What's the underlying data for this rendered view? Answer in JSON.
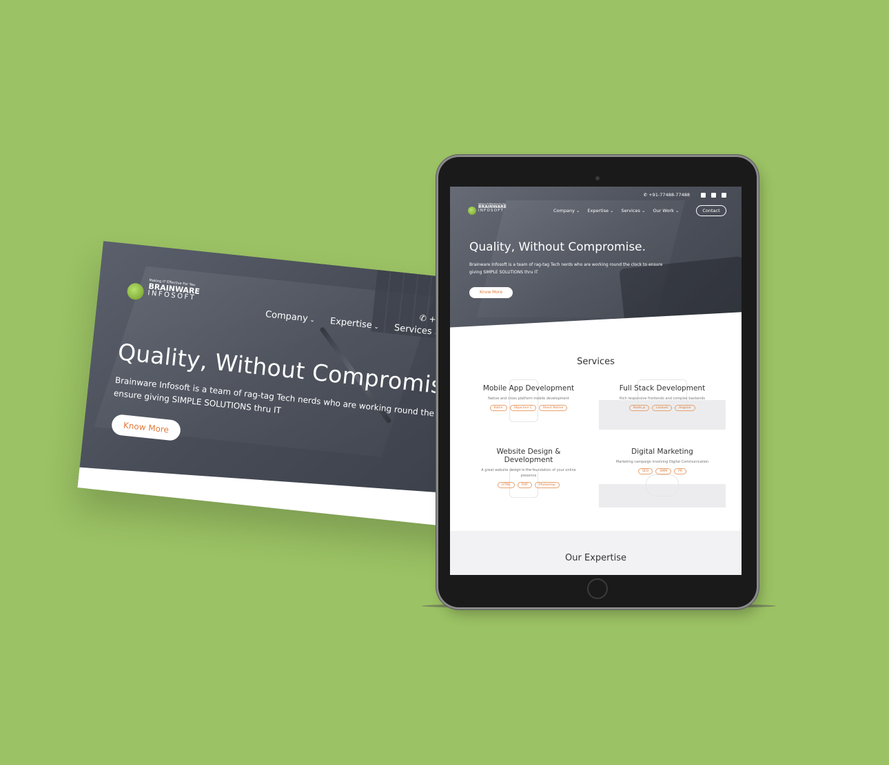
{
  "colors": {
    "background": "#9bc264",
    "accent": "#e07a3a",
    "hero": "#4d525c"
  },
  "brand": {
    "tagline": "Making IT Effective For You",
    "name_line1": "BRAINWARE",
    "name_line2": "INFOSOFT"
  },
  "hero": {
    "title": "Quality, Without Compromise.",
    "subtitle": "Brainware Infosoft is a team of rag-tag Tech nerds who are working round the clock to ensure giving SIMPLE SOLUTIONS thru IT",
    "cta": "Know More"
  },
  "desktop": {
    "nav": [
      {
        "label": "Company"
      },
      {
        "label": "Expertise"
      },
      {
        "label": "Services"
      }
    ],
    "phone_fragment": "+",
    "subtitle_line1": "Brainware Infosoft is a team of rag-tag Tech nerds who are working round the clock t",
    "subtitle_line2": "ensure giving SIMPLE SOLUTIONS thru IT"
  },
  "tablet": {
    "phone": "+91-77488-77488",
    "social_icons": [
      "linkedin-icon",
      "facebook-icon",
      "youtube-icon"
    ],
    "nav": [
      {
        "label": "Company"
      },
      {
        "label": "Expertise"
      },
      {
        "label": "Services"
      },
      {
        "label": "Our Work"
      }
    ],
    "contact": "Contact",
    "services_title": "Services",
    "services": [
      {
        "title": "Mobile App Development",
        "desc": "Native and cross platform mobile development",
        "tags": [
          "Kotlin",
          "Objective C",
          "React Native"
        ]
      },
      {
        "title": "Full Stack Development",
        "desc": "Rich responsive frontends and complex backends",
        "tags": [
          "Node.js",
          "Laravel",
          "Angular"
        ]
      },
      {
        "title": "Website Design & Development",
        "desc": "A great website design is the foundation of your online presence",
        "tags": [
          "HTML",
          "PHP",
          "Photoshop"
        ]
      },
      {
        "title": "Digital Marketing",
        "desc": "Marketing campaign involving Digital Communication",
        "tags": [
          "SEO",
          "SMM",
          "PR"
        ]
      }
    ],
    "expertise_title": "Our Expertise"
  }
}
